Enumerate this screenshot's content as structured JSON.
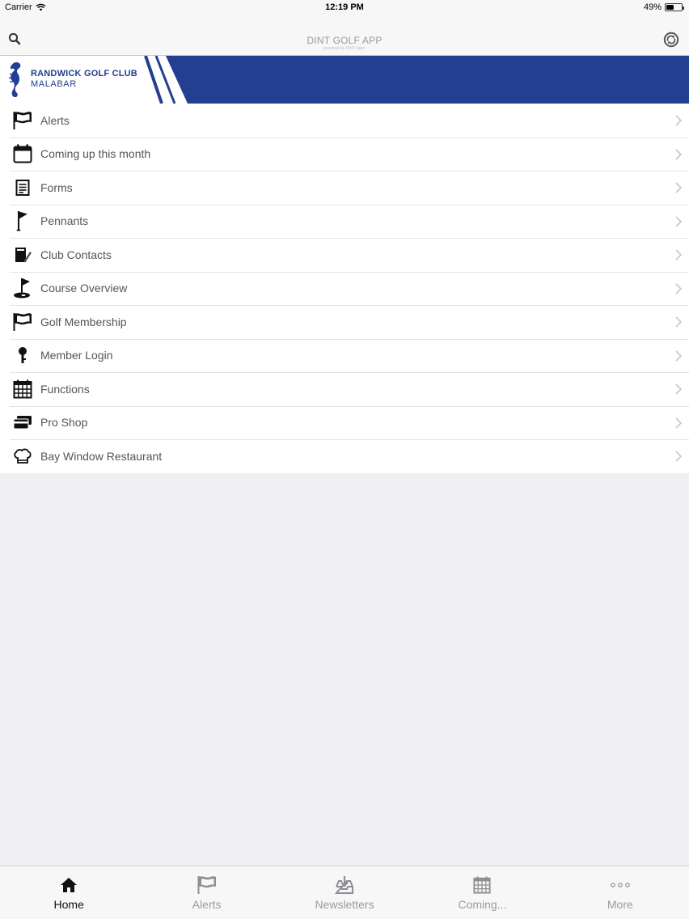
{
  "status": {
    "carrier": "Carrier",
    "time": "12:19 PM",
    "battery": "49%",
    "battery_level": 0.49
  },
  "nav": {
    "title": "DINT GOLF APP",
    "subtitle": "powered by DINT Apps"
  },
  "banner": {
    "club_name": "RANDWICK GOLF CLUB",
    "club_location": "MALABAR",
    "brand_color": "#233f92"
  },
  "menu": {
    "items": [
      {
        "label": "Alerts",
        "icon": "flag-icon"
      },
      {
        "label": "Coming up this month",
        "icon": "calendar-icon"
      },
      {
        "label": "Forms",
        "icon": "document-icon"
      },
      {
        "label": "Pennants",
        "icon": "pennant-icon"
      },
      {
        "label": "Club Contacts",
        "icon": "contacts-book-icon"
      },
      {
        "label": "Course Overview",
        "icon": "golf-hole-icon"
      },
      {
        "label": "Golf Membership",
        "icon": "flag-icon"
      },
      {
        "label": "Member Login",
        "icon": "key-icon"
      },
      {
        "label": "Functions",
        "icon": "calendar-grid-icon"
      },
      {
        "label": "Pro Shop",
        "icon": "credit-card-icon"
      },
      {
        "label": "Bay Window Restaurant",
        "icon": "chef-hat-icon"
      }
    ]
  },
  "tabs": [
    {
      "label": "Home",
      "icon": "home-icon",
      "active": true
    },
    {
      "label": "Alerts",
      "icon": "flag-icon",
      "active": false
    },
    {
      "label": "Newsletters",
      "icon": "inbox-download-icon",
      "active": false
    },
    {
      "label": "Coming...",
      "icon": "calendar-grid-icon",
      "active": false
    },
    {
      "label": "More",
      "icon": "more-dots-icon",
      "active": false
    }
  ]
}
